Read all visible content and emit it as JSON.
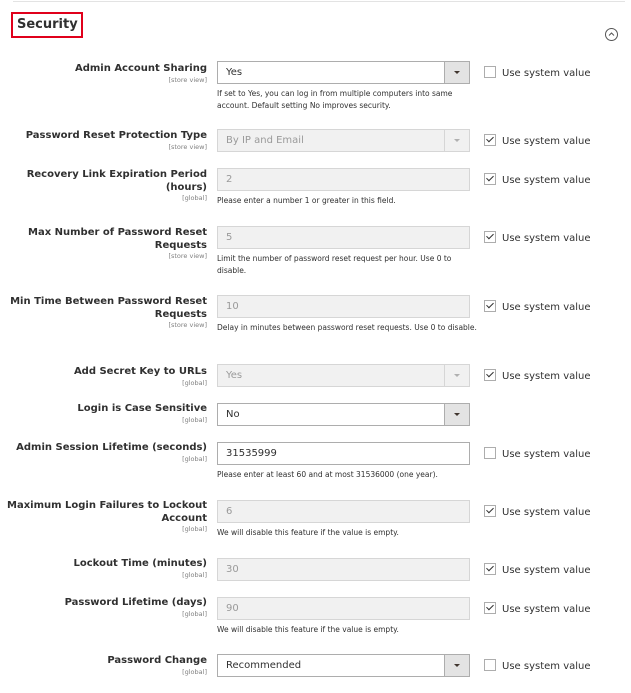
{
  "section": {
    "title": "Security",
    "collapse_icon": "chevron-up-circle-icon"
  },
  "use_system_label": "Use system value",
  "fields": [
    {
      "label": "Admin Account Sharing",
      "scope": "[store view]",
      "type": "select",
      "value": "Yes",
      "disabled": false,
      "note": "If set to Yes, you can log in from multiple computers into same account. Default setting No improves security.",
      "use_system": false
    },
    {
      "label": "Password Reset Protection Type",
      "scope": "[store view]",
      "type": "select",
      "value": "By IP and Email",
      "disabled": true,
      "note": "",
      "use_system": true
    },
    {
      "label": "Recovery Link Expiration Period (hours)",
      "scope": "[global]",
      "type": "text",
      "value": "2",
      "disabled": true,
      "note": "Please enter a number 1 or greater in this field.",
      "use_system": true
    },
    {
      "label": "Max Number of Password Reset Requests",
      "scope": "[store view]",
      "type": "text",
      "value": "5",
      "disabled": true,
      "note": "Limit the number of password reset request per hour. Use 0 to disable.",
      "use_system": true
    },
    {
      "label": "Min Time Between Password Reset Requests",
      "scope": "[store view]",
      "type": "text",
      "value": "10",
      "disabled": true,
      "note": "Delay in minutes between password reset requests. Use 0 to disable.",
      "use_system": true
    },
    {
      "label": "Add Secret Key to URLs",
      "scope": "[global]",
      "type": "select",
      "value": "Yes",
      "disabled": true,
      "note": "",
      "use_system": true
    },
    {
      "label": "Login is Case Sensitive",
      "scope": "[global]",
      "type": "select",
      "value": "No",
      "disabled": false,
      "note": "",
      "use_system": null
    },
    {
      "label": "Admin Session Lifetime (seconds)",
      "scope": "[global]",
      "type": "text",
      "value": "31535999",
      "disabled": false,
      "note": "Please enter at least 60 and at most 31536000 (one year).",
      "use_system": false
    },
    {
      "label": "Maximum Login Failures to Lockout Account",
      "scope": "[global]",
      "type": "text",
      "value": "6",
      "disabled": true,
      "note": "We will disable this feature if the value is empty.",
      "use_system": true
    },
    {
      "label": "Lockout Time (minutes)",
      "scope": "[global]",
      "type": "text",
      "value": "30",
      "disabled": true,
      "note": "",
      "use_system": true
    },
    {
      "label": "Password Lifetime (days)",
      "scope": "[global]",
      "type": "text",
      "value": "90",
      "disabled": true,
      "note": "We will disable this feature if the value is empty.",
      "use_system": true
    },
    {
      "label": "Password Change",
      "scope": "[global]",
      "type": "select",
      "value": "Recommended",
      "disabled": false,
      "note": "",
      "use_system": false
    }
  ]
}
